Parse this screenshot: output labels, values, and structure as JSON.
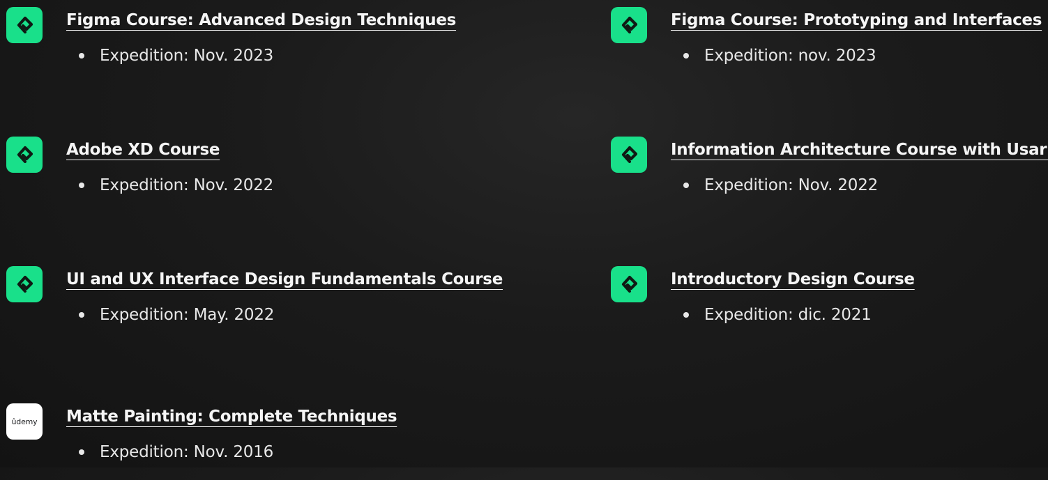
{
  "courses": [
    {
      "title": "Figma Course: Advanced Design Techniques",
      "detail": "Expedition: Nov. 2023",
      "logo": "platzi-icon"
    },
    {
      "title": "Figma Course: Prototyping and Interfaces",
      "detail": "Expedition: nov. 2023",
      "logo": "platzi-icon"
    },
    {
      "title": "Adobe XD Course",
      "detail": "Expedition: Nov. 2022",
      "logo": "platzi-icon"
    },
    {
      "title": "Information Architecture Course with Usaria",
      "detail": "Expedition: Nov. 2022",
      "logo": "platzi-icon"
    },
    {
      "title": "UI and UX Interface Design Fundamentals Course",
      "detail": "Expedition: May. 2022",
      "logo": "platzi-icon"
    },
    {
      "title": "Introductory Design Course",
      "detail": "Expedition: dic. 2021",
      "logo": "platzi-icon"
    },
    {
      "title": "Matte Painting: Complete Techniques",
      "detail": "Expedition: Nov. 2016",
      "logo": "udemy-logo",
      "logo_text": "ûdemy"
    }
  ],
  "colors": {
    "platzi_green": "#19e08a",
    "background": "#1a1a1a",
    "text": "#f5f5f5"
  }
}
